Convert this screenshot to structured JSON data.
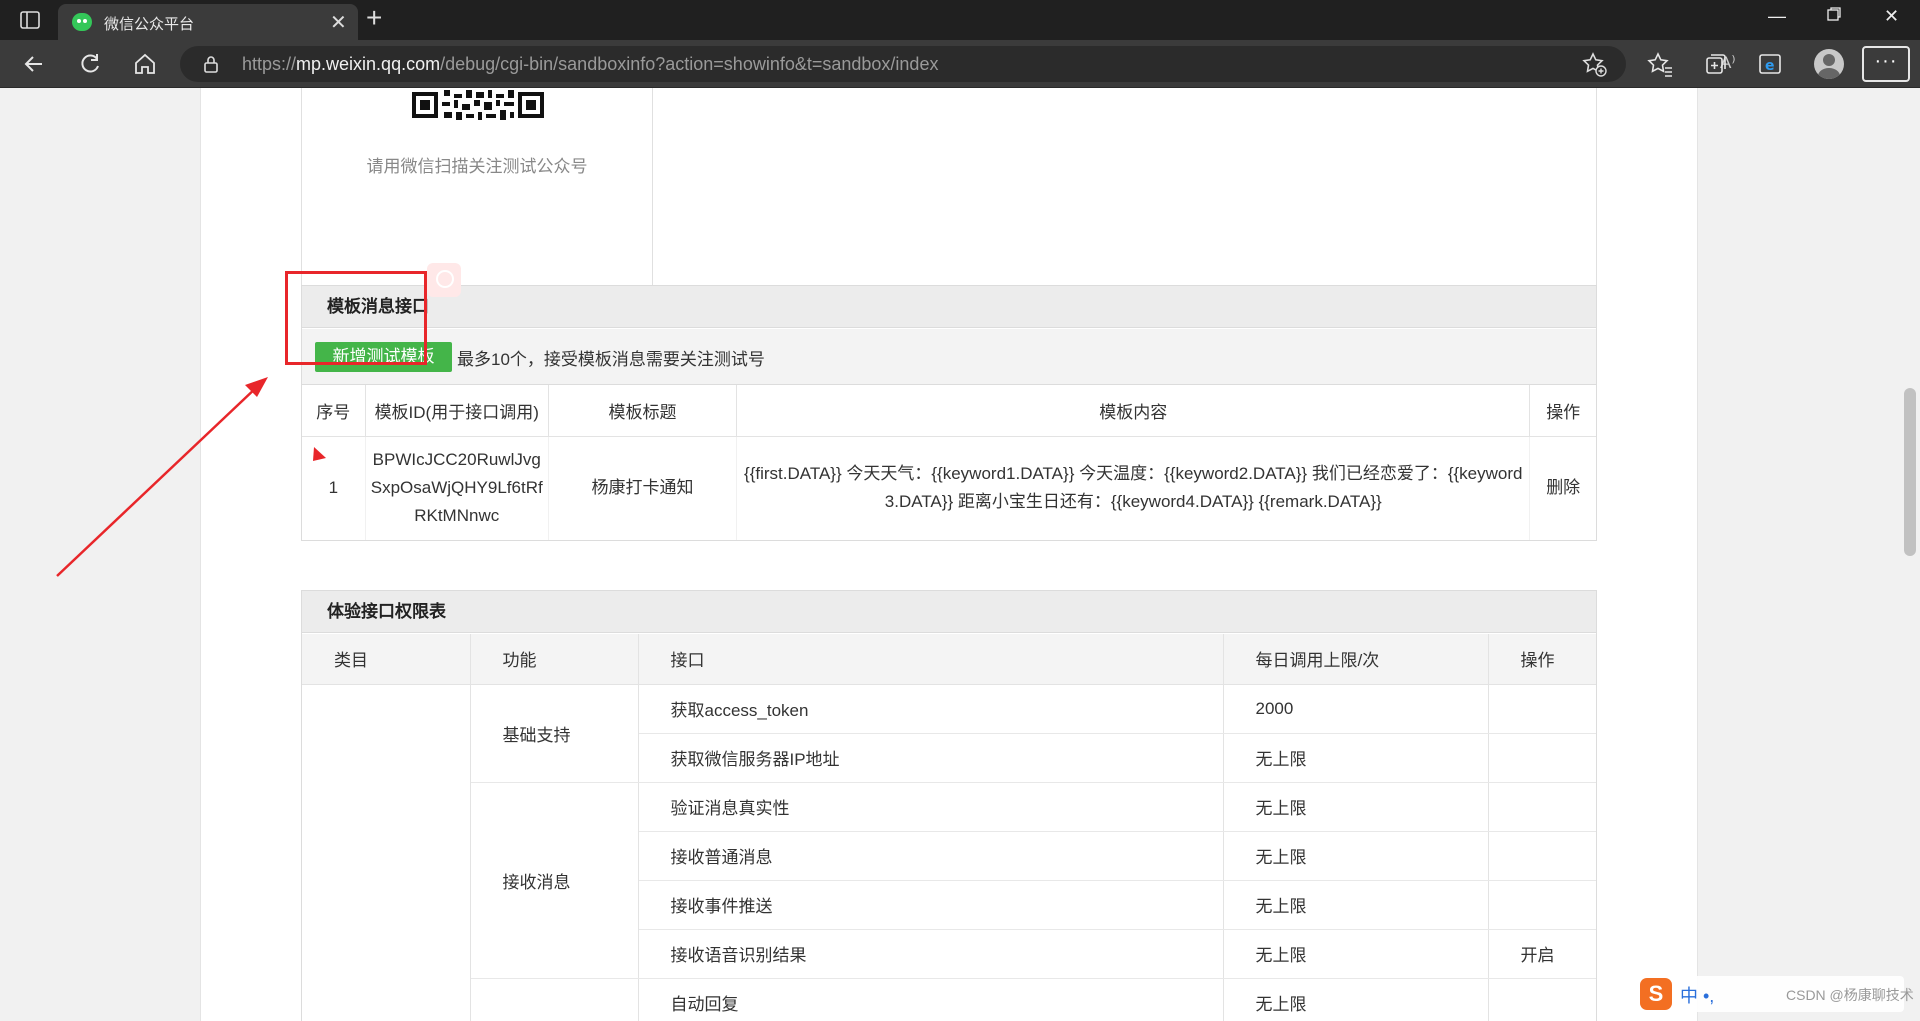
{
  "browser": {
    "tab_title": "微信公众平台",
    "url_prefix": "https://",
    "url_host": "mp.weixin.qq.com",
    "url_path": "/debug/cgi-bin/sandboxinfo?action=showinfo&t=sandbox/index",
    "read_aloud": "A⁾"
  },
  "qr_section": {
    "caption": "请用微信扫描关注测试公众号"
  },
  "template_section": {
    "title": "模板消息接口",
    "add_button": "新增测试模板",
    "hint": "最多10个，接受模板消息需要关注测试号",
    "columns": [
      "序号",
      "模板ID(用于接口调用)",
      "模板标题",
      "模板内容",
      "操作"
    ],
    "rows": [
      {
        "index": "1",
        "template_id": "BPWIcJCC20RuwlJvgSxpOsaWjQHY9Lf6tRfRKtMNnwc",
        "title": "杨康打卡通知",
        "content": "{{first.DATA}} 今天天气：{{keyword1.DATA}} 今天温度：{{keyword2.DATA}} 我们已经恋爱了：{{keyword3.DATA}} 距离小宝生日还有：{{keyword4.DATA}} {{remark.DATA}}",
        "action": "删除"
      }
    ]
  },
  "permission_section": {
    "title": "体验接口权限表",
    "columns": [
      "类目",
      "功能",
      "接口",
      "每日调用上限/次",
      "操作"
    ],
    "groups": [
      {
        "feature": "基础支持",
        "apis": [
          {
            "name": "获取access_token",
            "limit": "2000",
            "action": ""
          },
          {
            "name": "获取微信服务器IP地址",
            "limit": "无上限",
            "action": ""
          }
        ]
      },
      {
        "feature": "接收消息",
        "apis": [
          {
            "name": "验证消息真实性",
            "limit": "无上限",
            "action": ""
          },
          {
            "name": "接收普通消息",
            "limit": "无上限",
            "action": ""
          },
          {
            "name": "接收事件推送",
            "limit": "无上限",
            "action": ""
          },
          {
            "name": "接收语音识别结果",
            "limit": "无上限",
            "action": "开启"
          }
        ]
      },
      {
        "feature": "",
        "apis": [
          {
            "name": "自动回复",
            "limit": "无上限",
            "action": ""
          }
        ]
      }
    ]
  },
  "ime": {
    "logo": "S",
    "text": "中 •,",
    "watermark": "CSDN @杨康聊技术"
  },
  "colors": {
    "accent_green": "#44b549",
    "link_blue": "#459ae9",
    "annotation_red": "#e8262a"
  }
}
